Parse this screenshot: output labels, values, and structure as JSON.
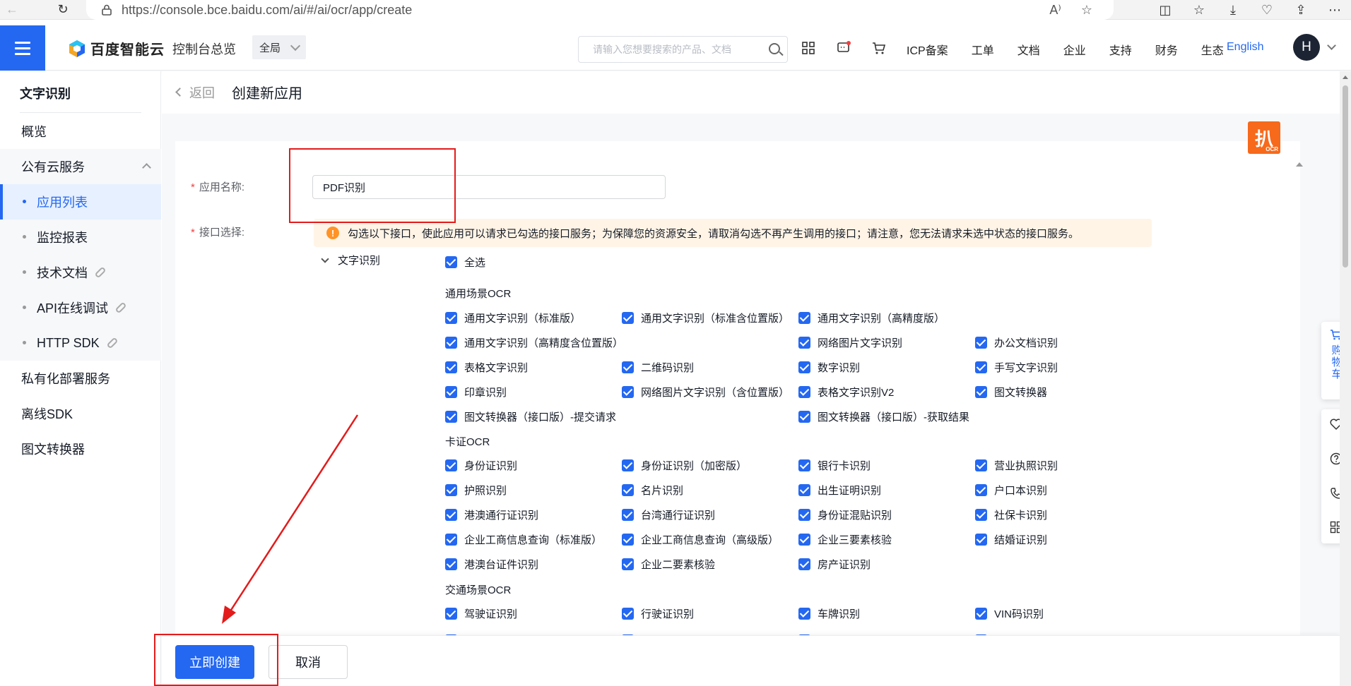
{
  "browser": {
    "url": "https://console.bce.baidu.com/ai/#/ai/ocr/app/create",
    "read_aloud_label": "A⁾"
  },
  "header": {
    "brand": "百度智能云",
    "home": "控制台总览",
    "region": "全局",
    "search_placeholder": "请输入您想要搜索的产品、文档",
    "links": [
      "ICP备案",
      "工单",
      "文档",
      "企业",
      "支持",
      "财务",
      "生态"
    ],
    "language": "English",
    "avatar_initial": "H"
  },
  "sidebar": {
    "title": "文字识别",
    "items": [
      {
        "label": "概览"
      },
      {
        "label": "公有云服务"
      },
      {
        "label": "应用列表"
      },
      {
        "label": "监控报表"
      },
      {
        "label": "技术文档"
      },
      {
        "label": "API在线调试"
      },
      {
        "label": "HTTP SDK"
      },
      {
        "label": "私有化部署服务"
      },
      {
        "label": "离线SDK"
      },
      {
        "label": "图文转换器"
      }
    ]
  },
  "page": {
    "back": "返回",
    "title": "创建新应用",
    "badge_text": "扒",
    "badge_sub": "OCR"
  },
  "form": {
    "name_label": "应用名称:",
    "name_value": "PDF识别",
    "api_label": "接口选择:",
    "notice": "勾选以下接口，使此应用可以请求已勾选的接口服务；为保障您的资源安全，请取消勾选不再产生调用的接口；请注意，您无法请求未选中状态的接口服务。",
    "group": "文字识别",
    "select_all": "全选",
    "cat_general": "通用场景OCR",
    "general": {
      "r1": [
        "通用文字识别（标准版）",
        "通用文字识别（标准含位置版）",
        "通用文字识别（高精度版）"
      ],
      "r2a": "通用文字识别（高精度含位置版）",
      "r2c": [
        "网络图片文字识别",
        "办公文档识别"
      ],
      "r3": [
        "表格文字识别",
        "二维码识别",
        "数字识别",
        "手写文字识别"
      ],
      "r4": [
        "印章识别",
        "网络图片文字识别（含位置版）",
        "表格文字识别V2",
        "图文转换器"
      ],
      "r5a": "图文转换器（接口版）-提交请求",
      "r5c": "图文转换器（接口版）-获取结果"
    },
    "cat_card": "卡证OCR",
    "card": {
      "r1": [
        "身份证识别",
        "身份证识别（加密版）",
        "银行卡识别",
        "营业执照识别"
      ],
      "r2": [
        "护照识别",
        "名片识别",
        "出生证明识别",
        "户口本识别"
      ],
      "r3": [
        "港澳通行证识别",
        "台湾通行证识别",
        "身份证混贴识别",
        "社保卡识别"
      ],
      "r4": [
        "企业工商信息查询（标准版）",
        "企业工商信息查询（高级版）",
        "企业三要素核验",
        "结婚证识别"
      ],
      "r5": [
        "港澳台证件识别",
        "企业二要素核验",
        "房产证识别"
      ]
    },
    "cat_traffic": "交通场景OCR",
    "traffic": {
      "r1": [
        "驾驶证识别",
        "行驶证识别",
        "车牌识别",
        "VIN码识别"
      ]
    }
  },
  "footer": {
    "create": "立即创建",
    "cancel": "取消"
  },
  "float": {
    "cart": "购物车"
  },
  "colors": {
    "primary": "#2468f2",
    "annotation": "#e31b1b",
    "warning": "#ff9326"
  }
}
